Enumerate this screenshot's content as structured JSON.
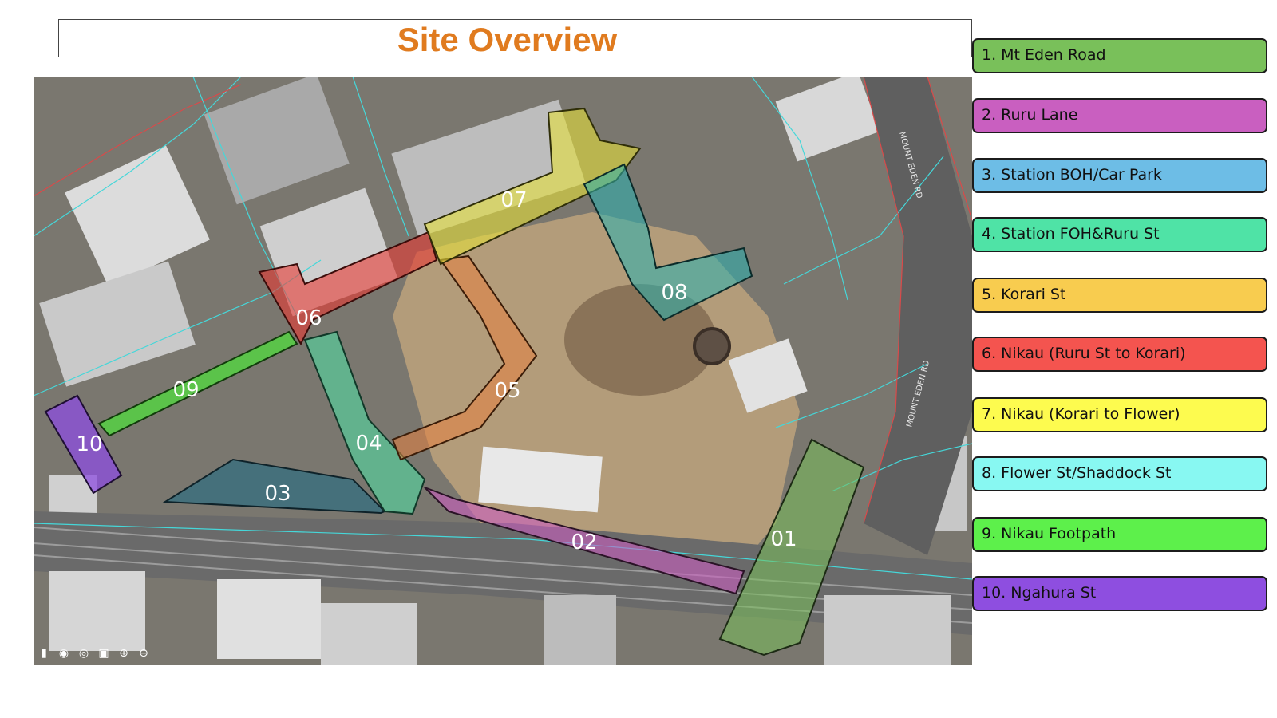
{
  "title": "Site Overview",
  "legend": [
    {
      "label": "1. Mt Eden Road",
      "color": "#79c05a"
    },
    {
      "label": "2. Ruru Lane",
      "color": "#c95fc0"
    },
    {
      "label": "3. Station BOH/Car Park",
      "color": "#6dbde6"
    },
    {
      "label": "4. Station FOH&Ruru St",
      "color": "#4fe3a6"
    },
    {
      "label": "5. Korari St",
      "color": "#f8cc4f"
    },
    {
      "label": "6. Nikau (Ruru St to Korari)",
      "color": "#f4544f"
    },
    {
      "label": "7. Nikau (Korari to Flower)",
      "color": "#fdfb4f"
    },
    {
      "label": "8. Flower St/Shaddock St",
      "color": "#88f8f2"
    },
    {
      "label": "9. Nikau Footpath",
      "color": "#5df04b"
    },
    {
      "label": "10. Ngahura St",
      "color": "#8e4ee0"
    }
  ],
  "zones": {
    "z01": "01",
    "z02": "02",
    "z03": "03",
    "z04": "04",
    "z05": "05",
    "z06": "06",
    "z07": "07",
    "z08": "08",
    "z09": "09",
    "z10": "10"
  },
  "street_labels": {
    "mount_eden_rd": "MOUNT EDEN RD",
    "mount_eden_rd_2": "MOUNT EDEN RD"
  },
  "map_tools": [
    "bookmark-icon",
    "camera-icon",
    "locate-icon",
    "fullscreen-icon",
    "zoom-in-icon",
    "zoom-out-icon"
  ]
}
